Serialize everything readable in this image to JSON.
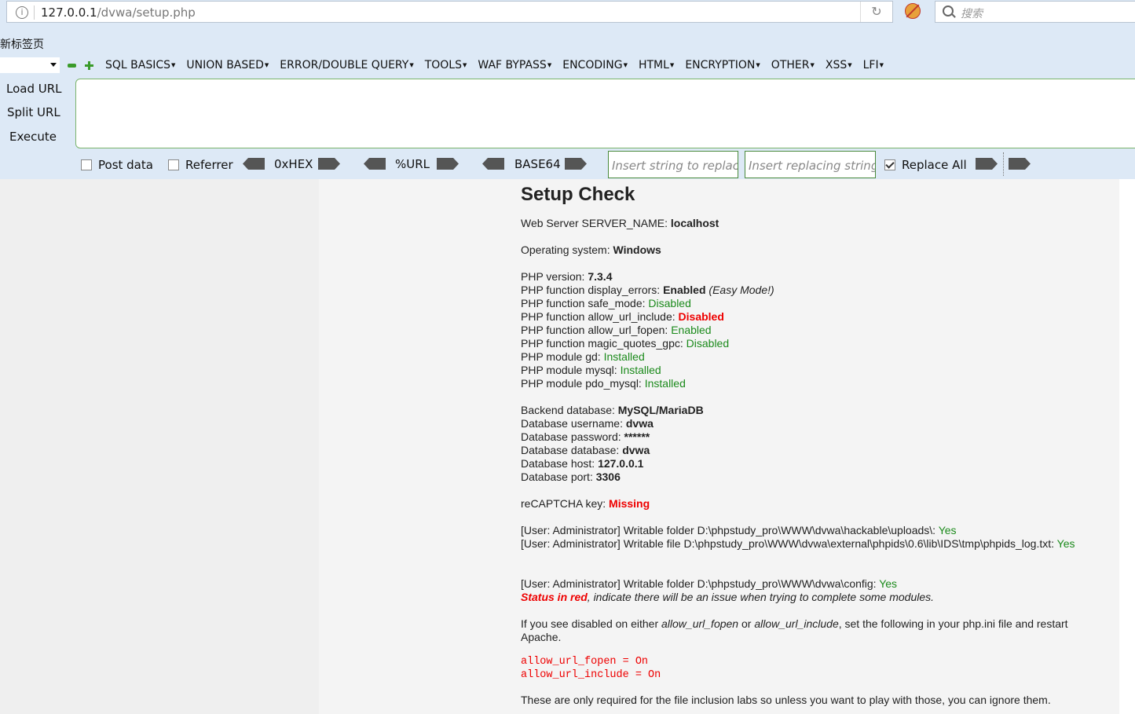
{
  "browser": {
    "url_host": "127.0.0.1",
    "url_path": "/dvwa/setup.php",
    "search_placeholder": "搜索",
    "tab_title": "新标签页"
  },
  "hackbar": {
    "menu": [
      "SQL BASICS",
      "UNION BASED",
      "ERROR/DOUBLE QUERY",
      "TOOLS",
      "WAF BYPASS",
      "ENCODING",
      "HTML",
      "ENCRYPTION",
      "OTHER",
      "XSS",
      "LFI"
    ],
    "load_url": "Load URL",
    "split_url": "Split URL",
    "execute": "Execute",
    "post_data": "Post data",
    "referrer": "Referrer",
    "hex": "0xHEX",
    "urlenc": "%URL",
    "base64": "BASE64",
    "replace_placeholder": "Insert string to replace",
    "replacing_placeholder": "Insert replacing string",
    "replace_all": "Replace All"
  },
  "setup": {
    "title": "Setup Check",
    "server_name_label": "Web Server SERVER_NAME: ",
    "server_name": "localhost",
    "os_label": "Operating system: ",
    "os": "Windows",
    "php_version_label": "PHP version: ",
    "php_version": "7.3.4",
    "display_errors_label": "PHP function display_errors: ",
    "display_errors": "Enabled",
    "display_errors_note": "(Easy Mode!)",
    "safe_mode_label": "PHP function safe_mode: ",
    "safe_mode": "Disabled",
    "allow_url_include_label": "PHP function allow_url_include: ",
    "allow_url_include": "Disabled",
    "allow_url_fopen_label": "PHP function allow_url_fopen: ",
    "allow_url_fopen": "Enabled",
    "magic_quotes_label": "PHP function magic_quotes_gpc: ",
    "magic_quotes": "Disabled",
    "gd_label": "PHP module gd: ",
    "gd": "Installed",
    "mysql_label": "PHP module mysql: ",
    "mysql": "Installed",
    "pdo_label": "PHP module pdo_mysql: ",
    "pdo": "Installed",
    "backend_label": "Backend database: ",
    "backend": "MySQL/MariaDB",
    "db_user_label": "Database username: ",
    "db_user": "dvwa",
    "db_pass_label": "Database password: ",
    "db_pass": "******",
    "db_db_label": "Database database: ",
    "db_db": "dvwa",
    "db_host_label": "Database host: ",
    "db_host": "127.0.0.1",
    "db_port_label": "Database port: ",
    "db_port": "3306",
    "recaptcha_label": "reCAPTCHA key: ",
    "recaptcha": "Missing",
    "writable_uploads_label": "[User: Administrator] Writable folder D:\\phpstudy_pro\\WWW\\dvwa\\hackable\\uploads\\: ",
    "writable_uploads": "Yes",
    "writable_log_label": "[User: Administrator] Writable file D:\\phpstudy_pro\\WWW\\dvwa\\external\\phpids\\0.6\\lib\\IDS\\tmp\\phpids_log.txt: ",
    "writable_log": "Yes",
    "writable_config_label": "[User: Administrator] Writable folder D:\\phpstudy_pro\\WWW\\dvwa\\config: ",
    "writable_config": "Yes",
    "status_red": "Status in red",
    "status_red_rest": ", indicate there will be an issue when trying to complete some modules.",
    "disabled_note_1": "If you see disabled on either ",
    "disabled_note_fopen": "allow_url_fopen",
    "disabled_note_or": " or ",
    "disabled_note_include": "allow_url_include",
    "disabled_note_2": ", set the following in your php.ini file and restart",
    "disabled_note_3": "Apache.",
    "code_line_1": "allow_url_fopen = On",
    "code_line_2": "allow_url_include = On",
    "footer_note": "These are only required for the file inclusion labs so unless you want to play with those, you can ignore them."
  }
}
